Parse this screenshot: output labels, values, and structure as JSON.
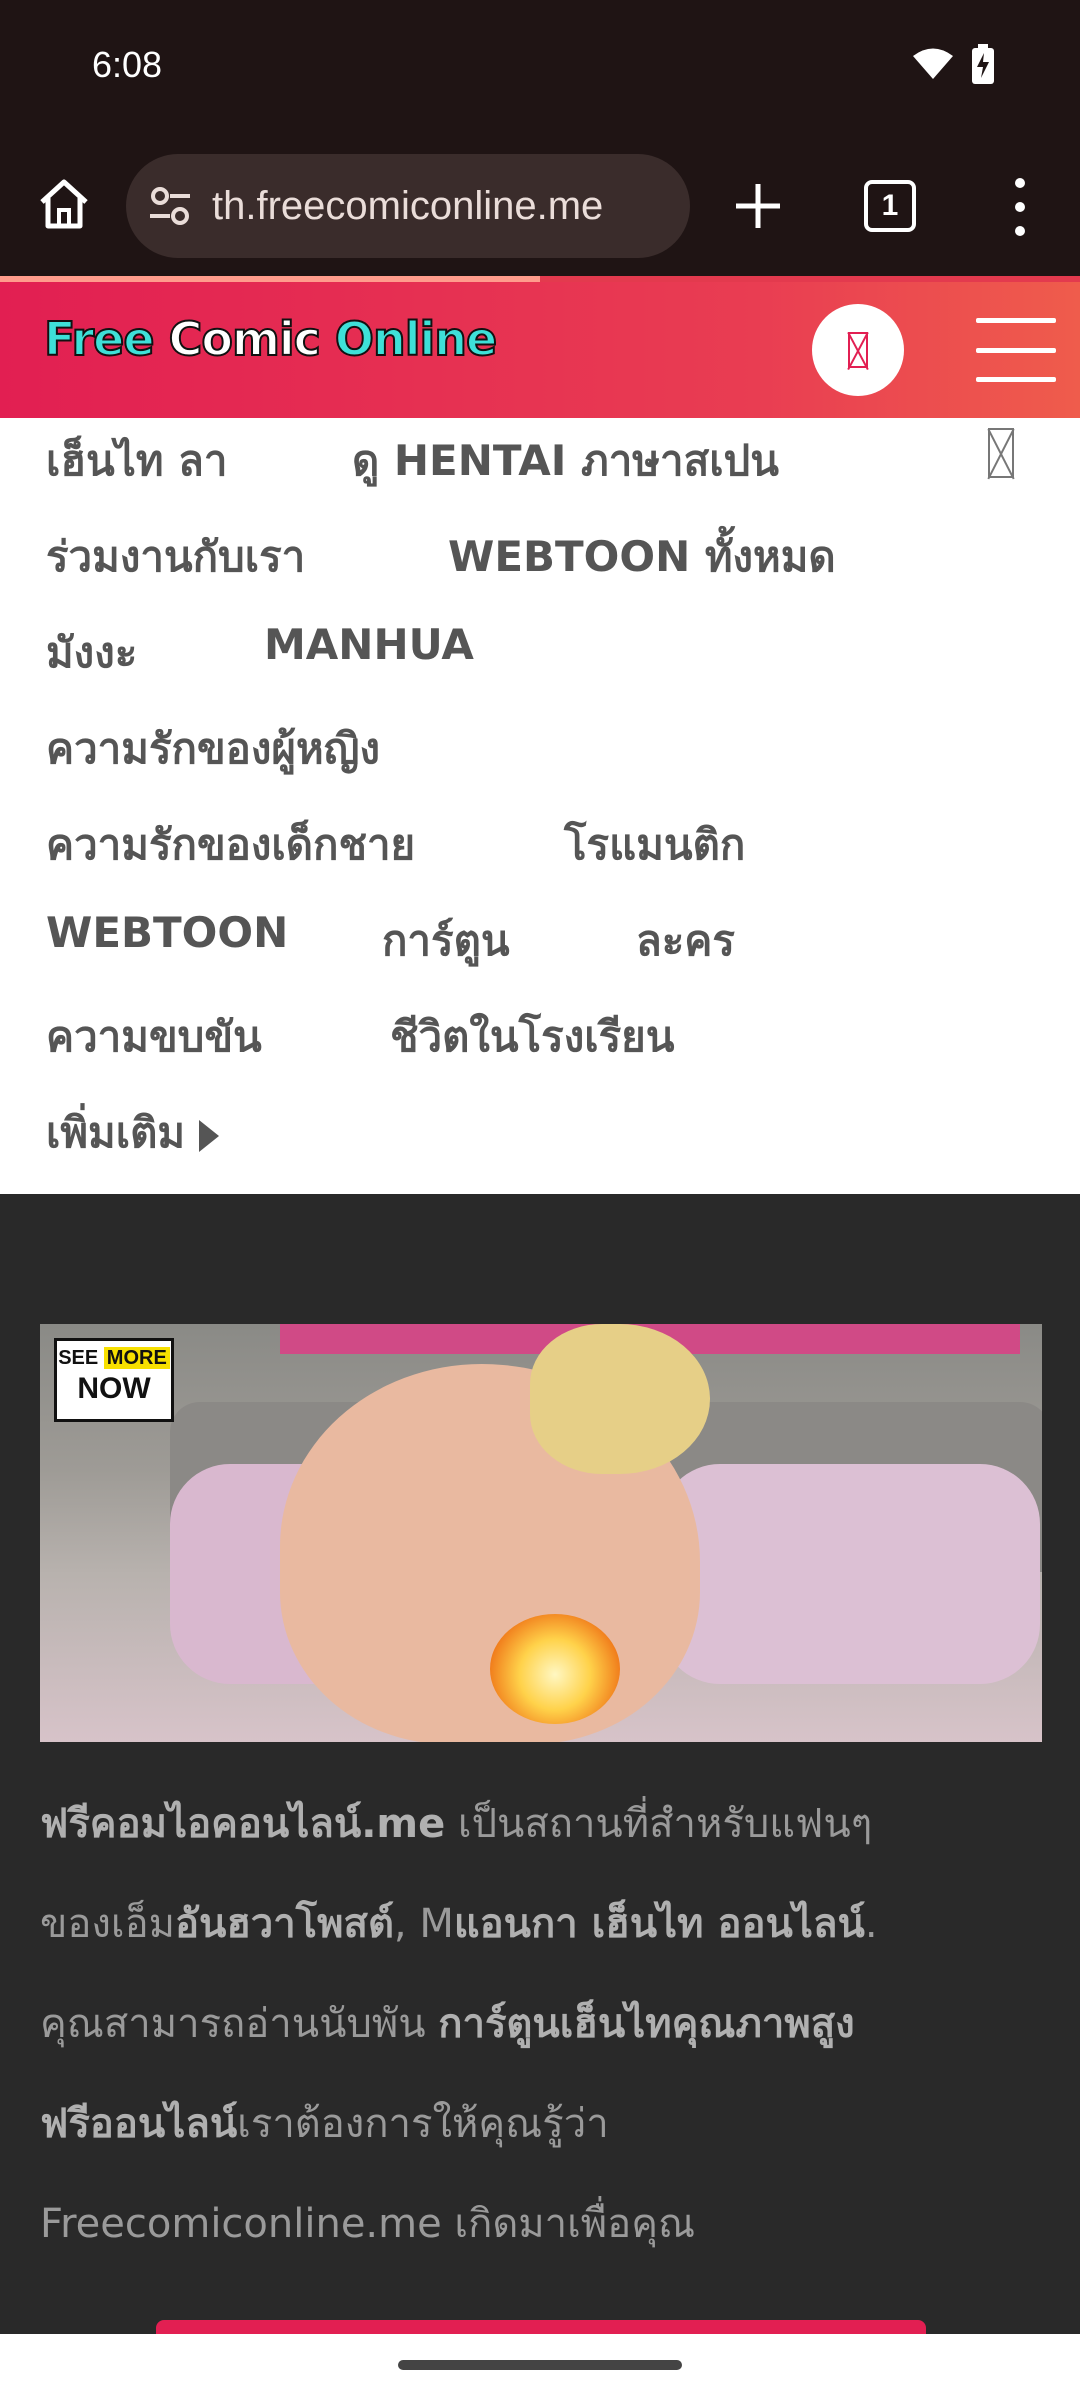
{
  "status_bar": {
    "time": "6:08"
  },
  "browser": {
    "url": "th.freecomiconline.me",
    "tab_count": "1",
    "page_load_progress": 0.5
  },
  "site": {
    "logo": {
      "word1": "Free",
      "word2": "Comic",
      "word3": "Online"
    }
  },
  "nav": {
    "items": [
      "เฮ็นไท ลา",
      "ดู HENTAI ภาษาสเปน",
      "ร่วมงานกับเรา",
      "WEBTOON ทั้งหมด",
      "มังงะ",
      "MANHUA",
      "ความรักของผู้หญิง",
      "ความรักของเด็กชาย",
      "โรแมนติก",
      "WEBTOON",
      "การ์ตูน",
      "ละคร",
      "ความขบขัน",
      "ชีวิตในโรงเรียน",
      "เพิ่มเติม"
    ]
  },
  "ad": {
    "badge_line1_a": "SEE",
    "badge_line1_b": "MORE",
    "badge_line2": "NOW"
  },
  "description": {
    "p1_bold": "ฟรีคอมไอคอนไลน์.me",
    "p1_rest": " เป็นสถานที่สำหรับแฟนๆ",
    "p2_plain": "ของเอ็ม",
    "p2_bold1": "อันฮวาโพสต์",
    "p2_mid": ", M",
    "p2_bold2": "แอนกา เฮ็นไท ออนไลน์",
    "p2_end": ".",
    "p3_plain": "คุณสามารถอ่านนับพัน ",
    "p3_bold": "การ์ตูนเฮ็นไทคุณภาพสูง",
    "p4_bold": "ฟรีออนไลน์",
    "p4_rest": "เราต้องการให้คุณรู้ว่า",
    "p5": "Freecomiconline.me เกิดมาเพื่อคุณ"
  },
  "colors": {
    "brand_red": "#e21f52",
    "logo_cyan": "#3ee0d8",
    "content_bg": "#292929",
    "browser_bg": "#1f1414"
  },
  "icons": {
    "home": "home-icon",
    "site_settings": "tune-icon",
    "new_tab": "plus-icon",
    "tabs": "tab-switcher-icon",
    "menu": "more-vert-icon",
    "search": "search-icon",
    "hamburger": "hamburger-icon",
    "close": "close-icon",
    "more": "caret-right-icon"
  }
}
